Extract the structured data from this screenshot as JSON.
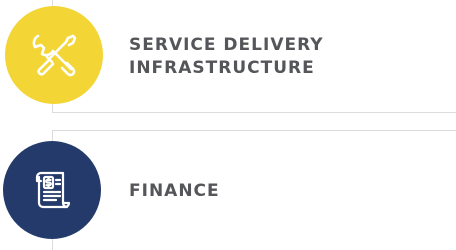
{
  "items": [
    {
      "title_line1": "SERVICE DELIVERY",
      "title_line2": "INFRASTRUCTURE",
      "icon": "wrench-screwdriver-icon",
      "color": "#f4d536"
    },
    {
      "title": "FINANCE",
      "icon": "dollar-receipt-icon",
      "color": "#233a6b"
    }
  ],
  "colors": {
    "label_text": "#55565a",
    "divider": "#dcdcdc"
  }
}
